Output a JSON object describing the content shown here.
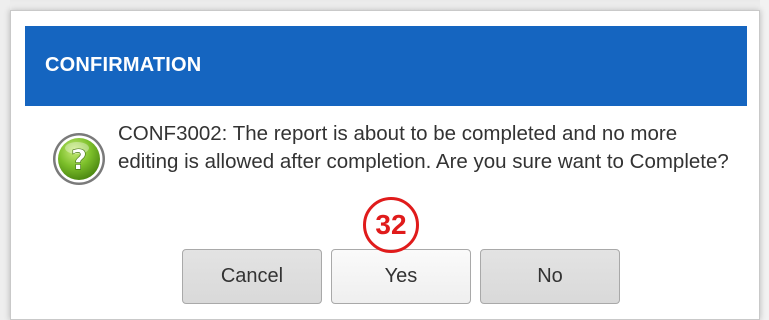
{
  "dialog": {
    "title": "CONFIRMATION",
    "header_color": "#1565c0",
    "icon": "question-icon",
    "message": "CONF3002: The report is about to be completed and no more editing is allowed after completion. Are you sure want to Complete?"
  },
  "buttons": {
    "cancel_label": "Cancel",
    "yes_label": "Yes",
    "no_label": "No"
  },
  "annotation": {
    "step_number": "32",
    "color": "#e01b1b"
  }
}
